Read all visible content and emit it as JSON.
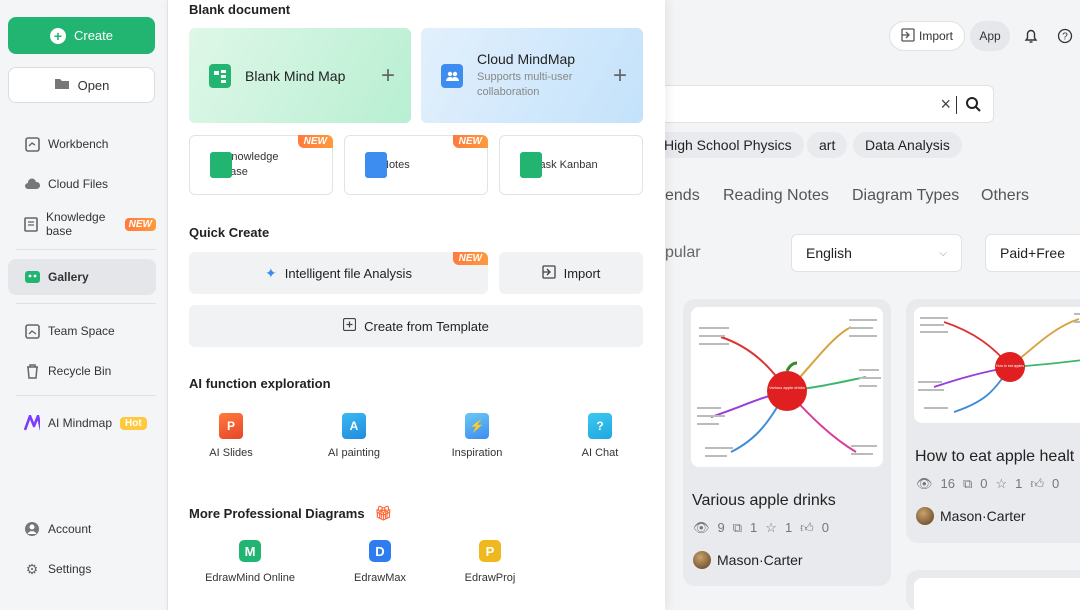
{
  "sidebar": {
    "create_label": "Create",
    "open_label": "Open",
    "items": [
      {
        "label": "Workbench",
        "icon": "workbench-icon"
      },
      {
        "label": "Cloud Files",
        "icon": "cloud-icon"
      },
      {
        "label": "Knowledge base",
        "icon": "book-icon",
        "badge": "NEW"
      },
      {
        "label": "Gallery",
        "icon": "gallery-icon"
      },
      {
        "label": "Team Space",
        "icon": "team-icon"
      },
      {
        "label": "Recycle Bin",
        "icon": "trash-icon"
      },
      {
        "label": "AI Mindmap",
        "icon": "ai-mindmap-icon",
        "badge": "Hot"
      },
      {
        "label": "Account",
        "icon": "account-icon"
      },
      {
        "label": "Settings",
        "icon": "gear-icon"
      }
    ]
  },
  "panel": {
    "blank_title": "Blank document",
    "blank_mind_map": "Blank Mind Map",
    "cloud_mindmap": "Cloud MindMap",
    "cloud_mindmap_sub": "Supports multi-user collaboration",
    "knowledge_base": "Knowledge base",
    "notes": "Notes",
    "task_kanban": "Task Kanban",
    "new_badge": "NEW",
    "quick_title": "Quick Create",
    "intelligent": "Intelligent file Analysis",
    "import": "Import",
    "from_template": "Create from Template",
    "ai_title": "AI function exploration",
    "ai_items": [
      "AI Slides",
      "AI painting",
      "Inspiration",
      "AI Chat"
    ],
    "pro_title": "More Professional Diagrams",
    "pro_items": [
      "EdrawMind Online",
      "EdrawMax",
      "EdrawProj"
    ]
  },
  "topbar": {
    "import": "Import",
    "app": "App"
  },
  "search": {
    "clear": "×"
  },
  "chips": [
    "High School Physics",
    "art",
    "Data Analysis"
  ],
  "tabs": [
    "ends",
    "Reading Notes",
    "Diagram Types",
    "Others"
  ],
  "filters": {
    "sort_partial": "pular",
    "language": "English",
    "price": "Paid+Free"
  },
  "cards": [
    {
      "title": "Various apple drinks",
      "views": "9",
      "copies": "1",
      "stars": "1",
      "likes": "0",
      "author": "Mason·Carter",
      "thumb_center": "Various apple drinks"
    },
    {
      "title": "How to eat apple healt",
      "views": "16",
      "copies": "0",
      "stars": "1",
      "likes": "0",
      "author": "Mason·Carter",
      "thumb_center": "How to eat apples"
    }
  ],
  "colors": {
    "accent_green": "#22b571",
    "new_badge": "#ff7a3d",
    "hot_badge": "#ffc93d"
  }
}
